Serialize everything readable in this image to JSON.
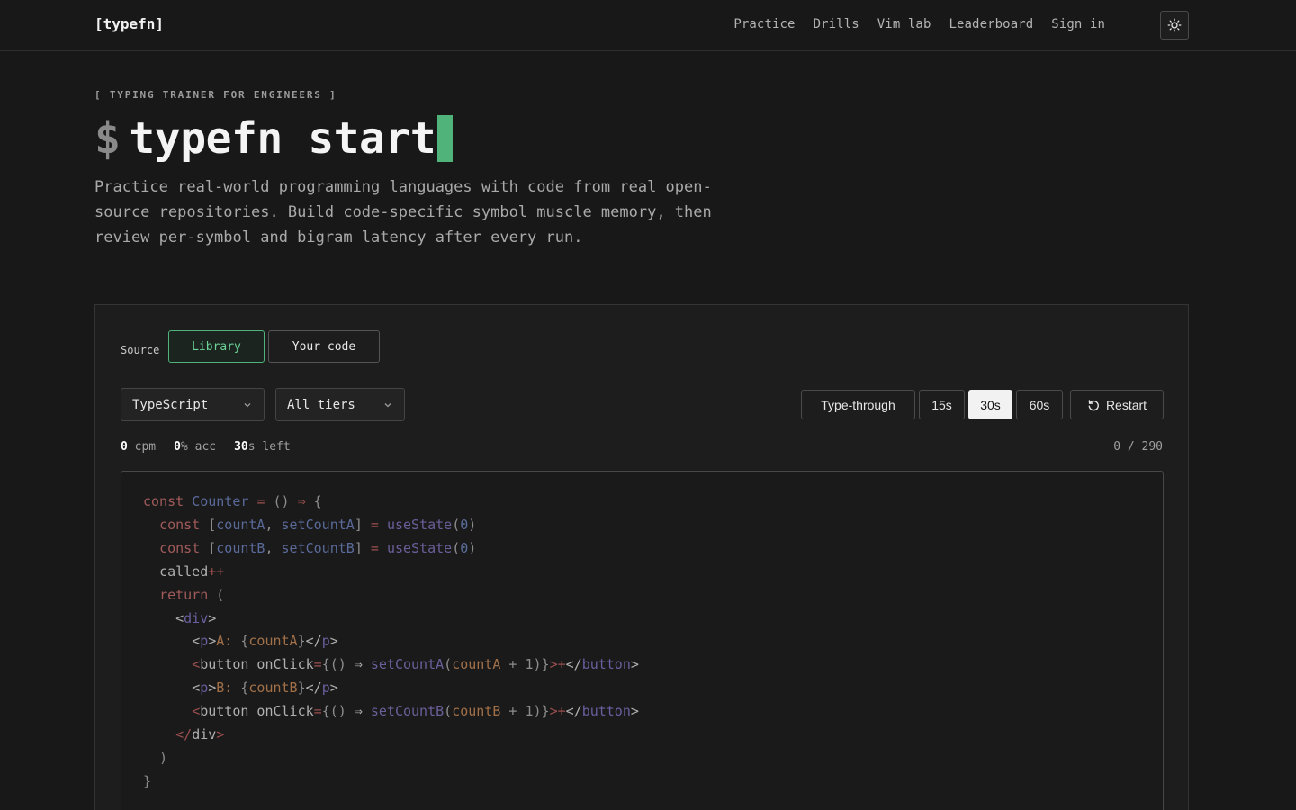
{
  "header": {
    "logo": "[typefn]",
    "nav": [
      "Practice",
      "Drills",
      "Vim lab",
      "Leaderboard",
      "Sign in"
    ],
    "theme_icon": "sun-icon"
  },
  "hero": {
    "eyebrow": "[ TYPING TRAINER FOR ENGINEERS ]",
    "prompt": "$",
    "command": "typefn start",
    "description": "Practice real-world programming languages with code from real open-source repositories. Build code-specific symbol muscle memory, then review per-symbol and bigram latency after every run."
  },
  "panel": {
    "source_label": "Source",
    "source_options": [
      "Library",
      "Your code"
    ],
    "source_selected": "Library",
    "language_select": "TypeScript",
    "tier_select": "All tiers",
    "modes": [
      "Type-through",
      "15s",
      "30s",
      "60s"
    ],
    "mode_selected": "30s",
    "restart_label": "Restart",
    "stats": {
      "cpm_value": "0",
      "cpm_unit": "cpm",
      "acc_value": "0",
      "acc_unit": "% acc",
      "time_value": "30",
      "time_unit": "s left"
    },
    "progress": "0 / 290"
  },
  "colors": {
    "accent": "#4fb37a",
    "background": "#181818",
    "panel": "#1d1d1d"
  }
}
